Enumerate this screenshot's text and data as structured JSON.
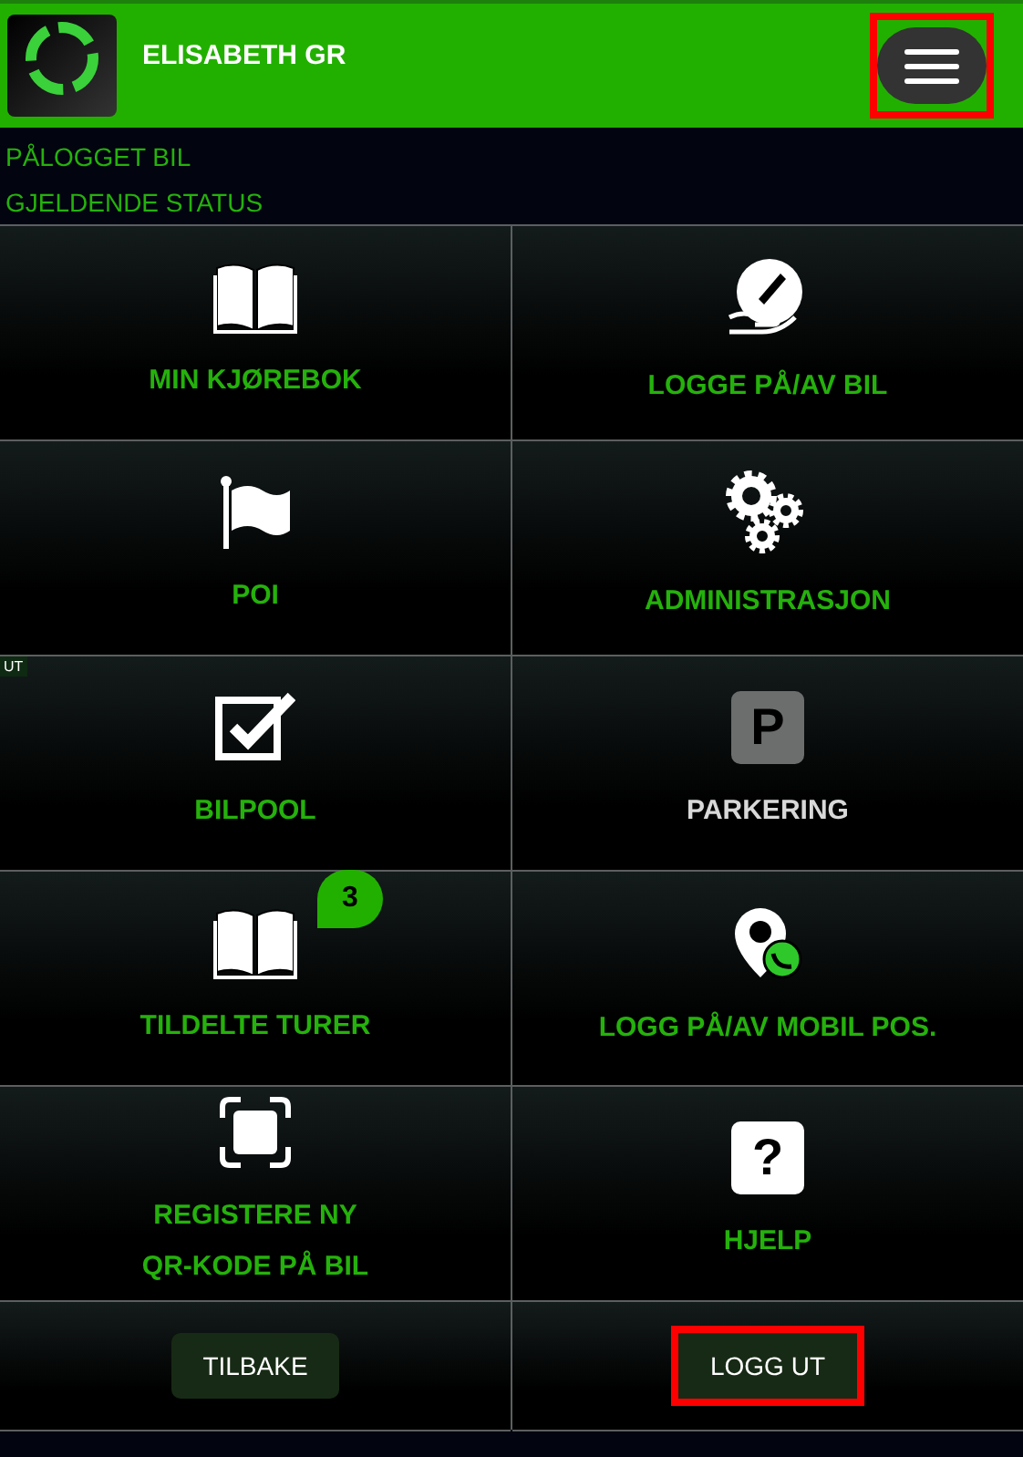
{
  "header": {
    "user": "ELISABETH GR",
    "menu_button": {
      "highlighted": true
    }
  },
  "status": [
    "PÅLOGGET BIL",
    "GJELDENDE STATUS"
  ],
  "tiles": [
    {
      "label": "MIN KJØREBOK",
      "kind": "book",
      "disabled": false
    },
    {
      "label": "LOGGE PÅ/AV BIL",
      "kind": "sign",
      "disabled": false
    },
    {
      "label": "POI",
      "kind": "flag",
      "disabled": false
    },
    {
      "label": "ADMINISTRASJON",
      "kind": "gears",
      "disabled": false
    },
    {
      "label": "BILPOOL",
      "kind": "checkbox",
      "disabled": false,
      "tag": "UT"
    },
    {
      "label": "PARKERING",
      "kind": "glyph",
      "glyph": "P",
      "disabled": true
    },
    {
      "label": "TILDELTE TURER",
      "kind": "book",
      "disabled": false,
      "badge": "3"
    },
    {
      "label": "LOGG PÅ/AV MOBIL POS.",
      "kind": "pin",
      "disabled": false
    },
    {
      "label": "REGISTERE NY\nQR-KODE PÅ BIL",
      "kind": "scan",
      "disabled": false
    },
    {
      "label": "HJELP",
      "kind": "glyph",
      "glyph": "?",
      "disabled": false
    }
  ],
  "footer": [
    {
      "label": "TILBAKE",
      "highlighted": false
    },
    {
      "label": "LOGG UT",
      "highlighted": true
    }
  ]
}
